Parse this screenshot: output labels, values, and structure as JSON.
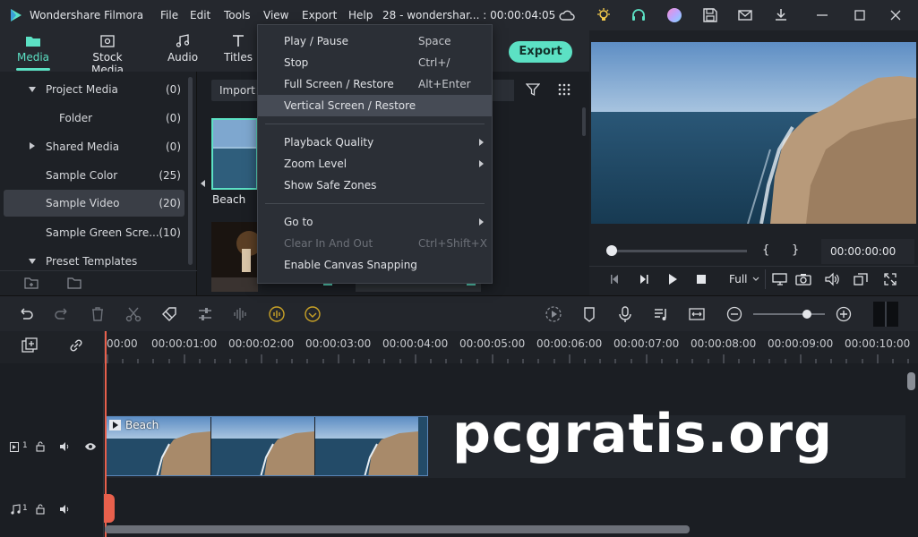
{
  "titlebar": {
    "app_name": "Wondershare Filmora",
    "menus": [
      "File",
      "Edit",
      "Tools",
      "View",
      "Export",
      "Help"
    ],
    "project": "28 - wondershar... : 00:00:04:05"
  },
  "tabs": [
    {
      "label": "Media",
      "icon": "folder-icon"
    },
    {
      "label": "Stock Media",
      "icon": "stock-media-icon"
    },
    {
      "label": "Audio",
      "icon": "music-note-icon"
    },
    {
      "label": "Titles",
      "icon": "text-icon"
    }
  ],
  "export_label": "Export",
  "media_panel": {
    "items": [
      {
        "label": "Project Media",
        "count": "(0)"
      },
      {
        "label": "Folder",
        "count": "(0)"
      },
      {
        "label": "Shared Media",
        "count": "(0)"
      },
      {
        "label": "Sample Color",
        "count": "(25)"
      },
      {
        "label": "Sample Video",
        "count": "(20)"
      },
      {
        "label": "Sample Green Scre...",
        "count": "(10)"
      },
      {
        "label": "Preset Templates",
        "count": ""
      }
    ],
    "import_label": "Import",
    "thumb_label": "Beach"
  },
  "view_menu": {
    "items": [
      {
        "label": "Play / Pause",
        "shortcut": "Space"
      },
      {
        "label": "Stop",
        "shortcut": "Ctrl+/"
      },
      {
        "label": "Full Screen / Restore",
        "shortcut": "Alt+Enter"
      },
      {
        "label": "Vertical Screen / Restore",
        "shortcut": ""
      },
      {
        "label": "Playback Quality",
        "shortcut": ""
      },
      {
        "label": "Zoom Level",
        "shortcut": ""
      },
      {
        "label": "Show Safe Zones",
        "shortcut": ""
      },
      {
        "label": "Go to",
        "shortcut": ""
      },
      {
        "label": "Clear In And Out",
        "shortcut": "Ctrl+Shift+X"
      },
      {
        "label": "Enable Canvas Snapping",
        "shortcut": ""
      }
    ]
  },
  "preview": {
    "brace_open": "{",
    "brace_close": "}",
    "timecode": "00:00:00:00",
    "quality": "Full"
  },
  "ruler": {
    "labels": [
      "00:00",
      "00:00:01:00",
      "00:00:02:00",
      "00:00:03:00",
      "00:00:04:00",
      "00:00:05:00",
      "00:00:06:00",
      "00:00:07:00",
      "00:00:08:00",
      "00:00:09:00",
      "00:00:10:00"
    ]
  },
  "tracks": {
    "video_track_num": "1",
    "audio_track_num": "1",
    "clip_label": "Beach"
  },
  "watermark": "pcgratis.org",
  "colors": {
    "accent": "#5ce1c4",
    "playhead": "#e8604c",
    "menu_bg": "#2b2f36"
  }
}
